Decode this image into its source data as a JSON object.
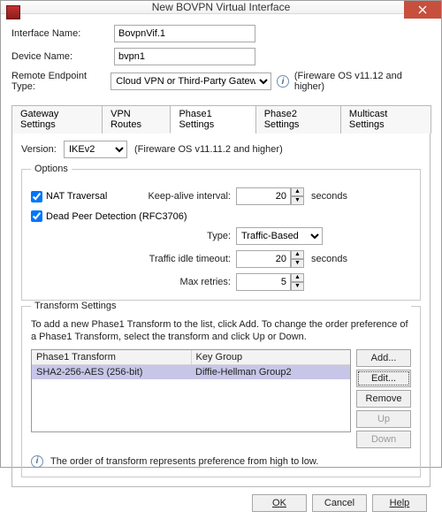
{
  "window": {
    "title": "New BOVPN Virtual Interface"
  },
  "fields": {
    "iface_label": "Interface Name:",
    "iface_value": "BovpnVif.1",
    "device_label": "Device Name:",
    "device_value": "bvpn1",
    "endpoint_label": "Remote Endpoint Type:",
    "endpoint_value": "Cloud VPN or Third-Party Gateway",
    "endpoint_hint": "(Fireware OS v11.12 and higher)"
  },
  "tabs": {
    "t0": "Gateway Settings",
    "t1": "VPN Routes",
    "t2": "Phase1 Settings",
    "t3": "Phase2 Settings",
    "t4": "Multicast Settings"
  },
  "p1": {
    "version_label": "Version:",
    "version_value": "IKEv2",
    "version_hint": "(Fireware OS v11.11.2 and higher)",
    "options_legend": "Options",
    "nat_label": "NAT Traversal",
    "keepalive_label": "Keep-alive interval:",
    "keepalive_value": "20",
    "keepalive_unit": "seconds",
    "dpd_label": "Dead Peer Detection (RFC3706)",
    "type_label": "Type:",
    "type_value": "Traffic-Based",
    "idle_label": "Traffic idle timeout:",
    "idle_value": "20",
    "idle_unit": "seconds",
    "retries_label": "Max retries:",
    "retries_value": "5"
  },
  "ts": {
    "legend": "Transform Settings",
    "help": "To add a new Phase1 Transform to the list, click Add. To change the order preference of a Phase1 Transform, select the transform and click Up or Down.",
    "col0": "Phase1 Transform",
    "col1": "Key Group",
    "row0_c0": "SHA2-256-AES (256-bit)",
    "row0_c1": "Diffie-Hellman Group2",
    "b_add": "Add...",
    "b_edit": "Edit...",
    "b_remove": "Remove",
    "b_up": "Up",
    "b_down": "Down",
    "footnote": "The order of transform represents preference from high to low."
  },
  "footer": {
    "ok": "OK",
    "cancel": "Cancel",
    "help": "Help"
  }
}
